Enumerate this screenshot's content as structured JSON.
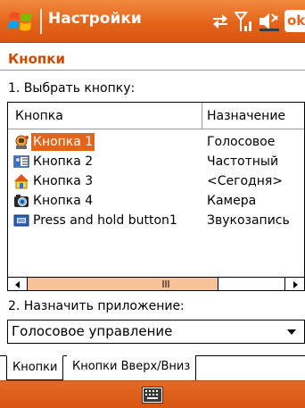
{
  "titlebar": {
    "title": "Настройки",
    "ok_label": "ok",
    "colors": {
      "bar": "#e4641a",
      "text": "#ffffff"
    }
  },
  "page": {
    "title": "Кнопки",
    "title_color": "#cc4b00",
    "step1_label": "1. Выбрать кнопку:",
    "step2_label": "2. Назначить приложение:"
  },
  "listview": {
    "columns": [
      "Кнопка",
      "Назначение"
    ],
    "rows": [
      {
        "icon": "voice-recorder-icon",
        "name": "Кнопка 1",
        "assignment": "Голосовое",
        "selected": true
      },
      {
        "icon": "contacts-card-icon",
        "name": "Кнопка 2",
        "assignment": "Частотный",
        "selected": false
      },
      {
        "icon": "home-today-icon",
        "name": "Кнопка 3",
        "assignment": "<Сегодня>",
        "selected": false
      },
      {
        "icon": "camera-icon",
        "name": "Кнопка 4",
        "assignment": "Камера",
        "selected": false
      },
      {
        "icon": "keyboard-button-icon",
        "name": "Press and hold button1",
        "assignment": "Звукозапись",
        "selected": false
      }
    ],
    "selection_color": "#e4641a"
  },
  "app_dropdown": {
    "value": "Голосовое управление"
  },
  "tabs": [
    {
      "label": "Кнопки",
      "active": true
    },
    {
      "label": "Кнопки Вверх/Вниз",
      "active": false
    }
  ],
  "menubar": {
    "input_icon": "keyboard-icon"
  },
  "scrollbar": {
    "grip_glyph": "III"
  }
}
